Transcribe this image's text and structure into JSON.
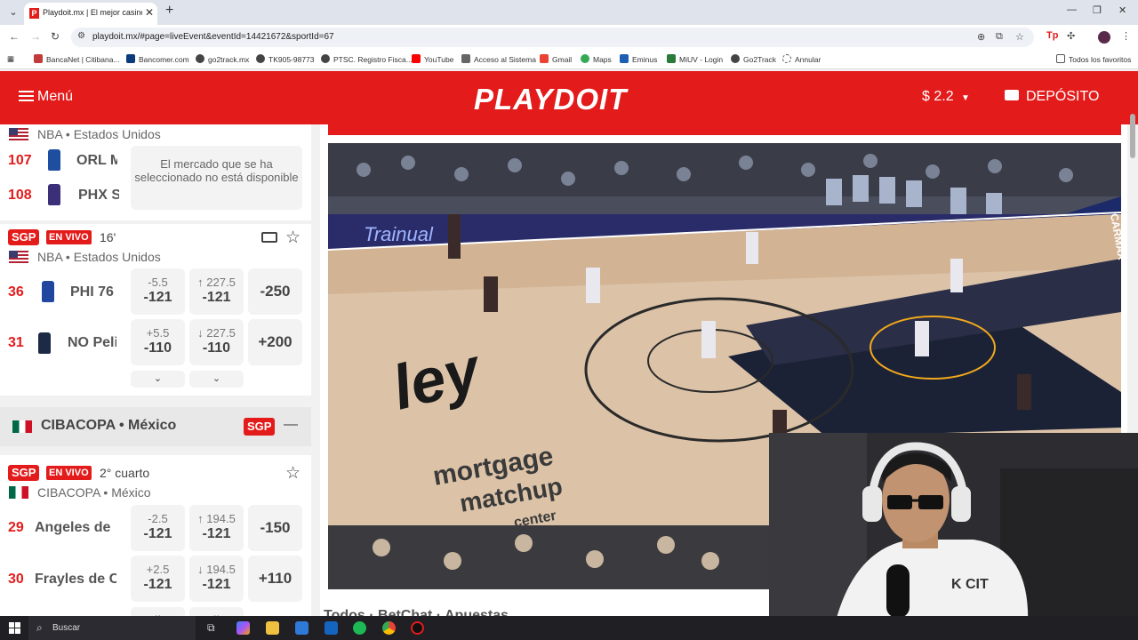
{
  "browser": {
    "tab_title": "Playdoit.mx | El mejor casino de",
    "favicon_letter": "P",
    "url": "playdoit.mx/#page=liveEvent&eventId=14421672&sportId=67",
    "bookmarks": [
      "BancaNet | Citibana...",
      "Bancomer.com",
      "go2track.mx",
      "TK905-98773",
      "PTSC. Registro Fisca...",
      "YouTube",
      "Acceso al Sistema",
      "Gmail",
      "Maps",
      "Eminus",
      "MiUV - Login",
      "Go2Track",
      "Annular"
    ],
    "all_bookmarks": "Todos los favoritos"
  },
  "header": {
    "menu_label": "Menú",
    "logo": "PLAYDOIT",
    "balance": "$ 2.2",
    "deposit_label": "DEPÓSITO",
    "accent_color": "#e41b1b"
  },
  "events": {
    "event1": {
      "league": "NBA • Estados Unidos",
      "teams": [
        {
          "num": "107",
          "name": "ORL M"
        },
        {
          "num": "108",
          "name": "PHX S"
        }
      ],
      "unavailable": "El mercado que se ha seleccionado no está disponible"
    },
    "event2": {
      "badge": "SGP",
      "live": "EN VIVO",
      "clock": "16'",
      "league": "NBA • Estados Unidos",
      "teams": [
        {
          "num": "36",
          "name": "PHI 76"
        },
        {
          "num": "31",
          "name": "NO Peli"
        }
      ],
      "odds": [
        {
          "spread_line": "-5.5",
          "spread_price": "-121",
          "total_line": "↑ 227.5",
          "total_price": "-121",
          "moneyline": "-250"
        },
        {
          "spread_line": "+5.5",
          "spread_price": "-110",
          "total_line": "↓ 227.5",
          "total_price": "-110",
          "moneyline": "+200"
        }
      ]
    },
    "section": {
      "title": "CIBACOPA • México",
      "badge": "SGP",
      "collapse": "—"
    },
    "event3": {
      "badge": "SGP",
      "live": "EN VIVO",
      "clock": "2° cuarto",
      "league": "CIBACOPA • México",
      "teams": [
        {
          "num": "29",
          "name": "Angeles de"
        },
        {
          "num": "30",
          "name": "Frayles de C"
        }
      ],
      "odds": [
        {
          "spread_line": "-2.5",
          "spread_price": "-121",
          "total_line": "↑ 194.5",
          "total_price": "-121",
          "moneyline": "-150"
        },
        {
          "spread_line": "+2.5",
          "spread_price": "-121",
          "total_line": "↓ 194.5",
          "total_price": "-121",
          "moneyline": "+110"
        }
      ]
    }
  },
  "video": {
    "banner_text": "Trainual",
    "arena_text_1": "mortgage",
    "arena_text_2": "matchup",
    "arena_text_3": "center",
    "sideline_text": "CARMAX",
    "court_word": "ley"
  },
  "main_tabs": "Todos · BetChat · Apuestas",
  "taskbar": {
    "search_label": "Buscar"
  }
}
